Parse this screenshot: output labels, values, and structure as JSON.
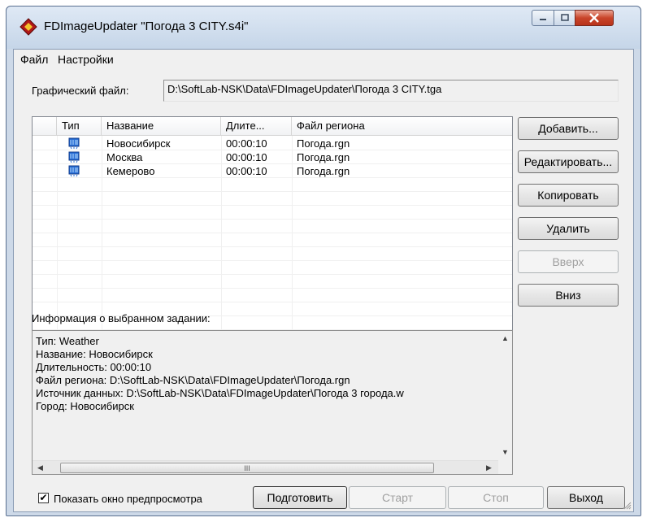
{
  "window": {
    "title": "FDImageUpdater \"Погода 3 CITY.s4i\"",
    "accent": "#1e57c8"
  },
  "menu": {
    "file": "Файл",
    "settings": "Настройки"
  },
  "graphic_file": {
    "label": "Графический файл:",
    "value": "D:\\SoftLab-NSK\\Data\\FDImageUpdater\\Погода 3 CITY.tga"
  },
  "table": {
    "columns": [
      "Тип",
      "Название",
      "Длите...",
      "Файл региона"
    ],
    "rows": [
      {
        "icon": "weather-icon",
        "name": "Новосибирск",
        "duration": "00:00:10",
        "region": "Погода.rgn"
      },
      {
        "icon": "weather-icon",
        "name": "Москва",
        "duration": "00:00:10",
        "region": "Погода.rgn"
      },
      {
        "icon": "weather-icon",
        "name": "Кемерово",
        "duration": "00:00:10",
        "region": "Погода.rgn"
      }
    ]
  },
  "buttons": {
    "add": "Добавить...",
    "edit": "Редактировать...",
    "copy": "Копировать",
    "delete": "Удалить",
    "up": "Вверх",
    "down": "Вниз"
  },
  "info": {
    "label": "Информация о выбранном задании:",
    "lines": [
      "Тип: Weather",
      "Название: Новосибирск",
      "Длительность: 00:00:10",
      "Файл региона: D:\\SoftLab-NSK\\Data\\FDImageUpdater\\Погода.rgn",
      "Источник данных: D:\\SoftLab-NSK\\Data\\FDImageUpdater\\Погода 3 города.w",
      "Город: Новосибирск"
    ],
    "scroll_thumb": "III"
  },
  "footer": {
    "preview_checkbox_label": "Показать окно предпросмотра",
    "preview_checked": true,
    "check_mark": "✔",
    "prepare": "Подготовить",
    "start": "Старт",
    "stop": "Стоп",
    "exit": "Выход"
  }
}
